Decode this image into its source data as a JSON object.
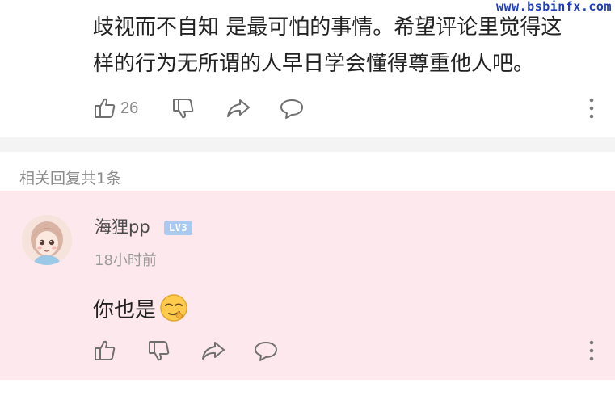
{
  "watermark": "www.bsbinfx.com",
  "top_comment": {
    "text_line1": "歧视而不自知 是最可怕的事情。希望评论里觉得这",
    "text_line2": "样的行为无所谓的人早日学会懂得尊重他人吧。",
    "like_count": "26",
    "icons": {
      "like": "thumbs-up-icon",
      "dislike": "thumbs-down-icon",
      "share": "share-icon",
      "comment": "comment-icon",
      "more": "more-vertical-icon"
    }
  },
  "replies_header": "相关回复共1条",
  "reply": {
    "username": "海狸pp",
    "level": "LV3",
    "timestamp": "18小时前",
    "text": "你也是",
    "emoji": "smirk-emoji",
    "background_color": "#fde8ee",
    "icons": {
      "like": "thumbs-up-icon",
      "dislike": "thumbs-down-icon",
      "share": "share-icon",
      "comment": "comment-icon",
      "more": "more-vertical-icon"
    }
  }
}
